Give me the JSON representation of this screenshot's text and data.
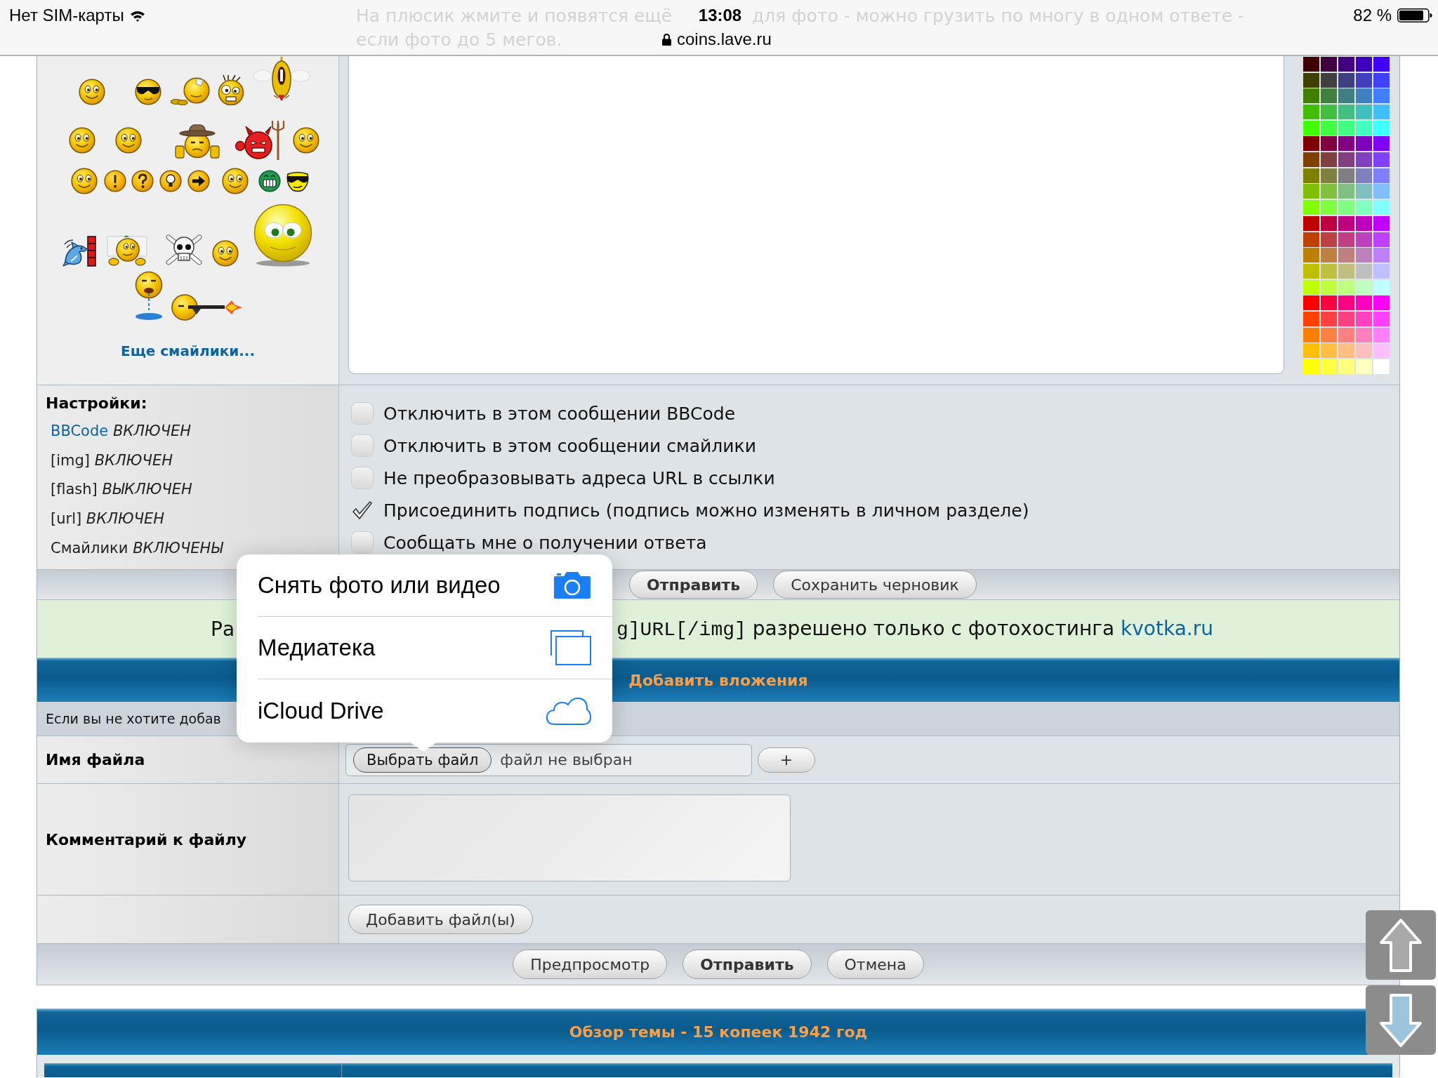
{
  "status_bar": {
    "carrier": "Нет SIM-карты",
    "time": "13:08",
    "url": "coins.lave.ru",
    "battery": "82 %"
  },
  "hint": {
    "line_1_start": "На плюсик жмите и появятся ещё",
    "line_1_end": "для фото - можно грузить по многу в одном ответе -",
    "line_2": "если фото до 5 мегов."
  },
  "smilies": {
    "more_link": "Еще смайлики..."
  },
  "palette": [
    {
      "color": "#400000"
    },
    {
      "color": "#400040"
    },
    {
      "color": "#400080"
    },
    {
      "color": "#4000bf"
    },
    {
      "color": "#4000ff"
    },
    {
      "color": "#404000"
    },
    {
      "color": "#404040"
    },
    {
      "color": "#404080"
    },
    {
      "color": "#4040bf"
    },
    {
      "color": "#4040ff"
    },
    {
      "color": "#408000"
    },
    {
      "color": "#408040"
    },
    {
      "color": "#408080"
    },
    {
      "color": "#4080bf"
    },
    {
      "color": "#4080ff"
    },
    {
      "color": "#40bf00"
    },
    {
      "color": "#40bf40"
    },
    {
      "color": "#40bf80"
    },
    {
      "color": "#40bfbf"
    },
    {
      "color": "#40bfff"
    },
    {
      "color": "#40ff00"
    },
    {
      "color": "#40ff40"
    },
    {
      "color": "#40ff80"
    },
    {
      "color": "#40ffbf"
    },
    {
      "color": "#40ffff"
    },
    {
      "color": "#800000"
    },
    {
      "color": "#800040"
    },
    {
      "color": "#800080"
    },
    {
      "color": "#8000bf"
    },
    {
      "color": "#8000ff"
    },
    {
      "color": "#804000"
    },
    {
      "color": "#804040"
    },
    {
      "color": "#804080"
    },
    {
      "color": "#8040bf"
    },
    {
      "color": "#8040ff"
    },
    {
      "color": "#808000"
    },
    {
      "color": "#808040"
    },
    {
      "color": "#808080"
    },
    {
      "color": "#8080bf"
    },
    {
      "color": "#8080ff"
    },
    {
      "color": "#80bf00"
    },
    {
      "color": "#80bf40"
    },
    {
      "color": "#80bf80"
    },
    {
      "color": "#80bfbf"
    },
    {
      "color": "#80bfff"
    },
    {
      "color": "#80ff00"
    },
    {
      "color": "#80ff40"
    },
    {
      "color": "#80ff80"
    },
    {
      "color": "#80ffbf"
    },
    {
      "color": "#80ffff"
    },
    {
      "color": "#bf0000"
    },
    {
      "color": "#bf0040"
    },
    {
      "color": "#bf0080"
    },
    {
      "color": "#bf00bf"
    },
    {
      "color": "#bf00ff"
    },
    {
      "color": "#bf4000"
    },
    {
      "color": "#bf4040"
    },
    {
      "color": "#bf4080"
    },
    {
      "color": "#bf40bf"
    },
    {
      "color": "#bf40ff"
    },
    {
      "color": "#bf8000"
    },
    {
      "color": "#bf8040"
    },
    {
      "color": "#bf8080"
    },
    {
      "color": "#bf80bf"
    },
    {
      "color": "#bf80ff"
    },
    {
      "color": "#bfbf00"
    },
    {
      "color": "#bfbf40"
    },
    {
      "color": "#bfbf80"
    },
    {
      "color": "#bfbfbf"
    },
    {
      "color": "#bfbfff"
    },
    {
      "color": "#bfff00"
    },
    {
      "color": "#bfff40"
    },
    {
      "color": "#bfff80"
    },
    {
      "color": "#bfffbf"
    },
    {
      "color": "#bfffff"
    },
    {
      "color": "#ff0000"
    },
    {
      "color": "#ff0040"
    },
    {
      "color": "#ff0080"
    },
    {
      "color": "#ff00bf"
    },
    {
      "color": "#ff00ff"
    },
    {
      "color": "#ff4000"
    },
    {
      "color": "#ff4040"
    },
    {
      "color": "#ff4080"
    },
    {
      "color": "#ff40bf"
    },
    {
      "color": "#ff40ff"
    },
    {
      "color": "#ff8000"
    },
    {
      "color": "#ff8040"
    },
    {
      "color": "#ff8080"
    },
    {
      "color": "#ff80bf"
    },
    {
      "color": "#ff80ff"
    },
    {
      "color": "#ffbf00"
    },
    {
      "color": "#ffbf40"
    },
    {
      "color": "#ffbf80"
    },
    {
      "color": "#ffbfbf"
    },
    {
      "color": "#ffbfff"
    },
    {
      "color": "#ffff00"
    },
    {
      "color": "#ffff40"
    },
    {
      "color": "#ffff80"
    },
    {
      "color": "#ffffbf"
    },
    {
      "color": "#ffffff"
    }
  ],
  "settings": {
    "title": "Настройки:",
    "items": [
      {
        "kind": "link",
        "name": "BBCode",
        "value": "ВКЛЮЧЕН"
      },
      {
        "kind": "text",
        "name": "[img]",
        "value": "ВКЛЮЧЕН"
      },
      {
        "kind": "text",
        "name": "[flash]",
        "value": "ВЫКЛЮЧЕН"
      },
      {
        "kind": "text",
        "name": "[url]",
        "value": "ВКЛЮЧЕН"
      },
      {
        "kind": "text",
        "name": "Смайлики",
        "value": "ВКЛЮЧЕНЫ"
      }
    ]
  },
  "options": [
    {
      "label": "Отключить в этом сообщении BBCode",
      "checked": false
    },
    {
      "label": "Отключить в этом сообщении смайлики",
      "checked": false
    },
    {
      "label": "Не преобразовывать адреса URL в ссылки",
      "checked": false
    },
    {
      "label": "Присоединить подпись (подпись можно изменять в личном разделе)",
      "checked": true
    },
    {
      "label": "Сообщать мне о получении ответа",
      "checked": false
    }
  ],
  "post_buttons": [
    {
      "label": "Отправить",
      "primary": true
    },
    {
      "label": "Сохранить черновик",
      "primary": false
    }
  ],
  "notice": {
    "start": "Ра",
    "code": "g]URL[/img]",
    "text": "разрешено только с фотохостинга",
    "link": "kvotka.ru"
  },
  "attachments": {
    "title": "Добавить вложения",
    "intro": "Если вы не хотите добав",
    "file_label": "Имя файла",
    "choose_button": "Выбрать файл",
    "file_status": "файл не выбран",
    "add_field_button": "+",
    "comment_label": "Комментарий к файлу",
    "add_files_button": "Добавить файл(ы)"
  },
  "form_buttons": [
    {
      "label": "Предпросмотр",
      "primary": false
    },
    {
      "label": "Отправить",
      "primary": true
    },
    {
      "label": "Отмена",
      "primary": false
    }
  ],
  "topic_review": {
    "title": "Обзор темы - 15 копеек 1942 год"
  },
  "photo_menu": {
    "items": [
      {
        "label": "Снять фото или видео",
        "kind": "camera"
      },
      {
        "label": "Медиатека",
        "kind": "library"
      },
      {
        "label": "iCloud Drive",
        "kind": "cloud"
      }
    ]
  }
}
